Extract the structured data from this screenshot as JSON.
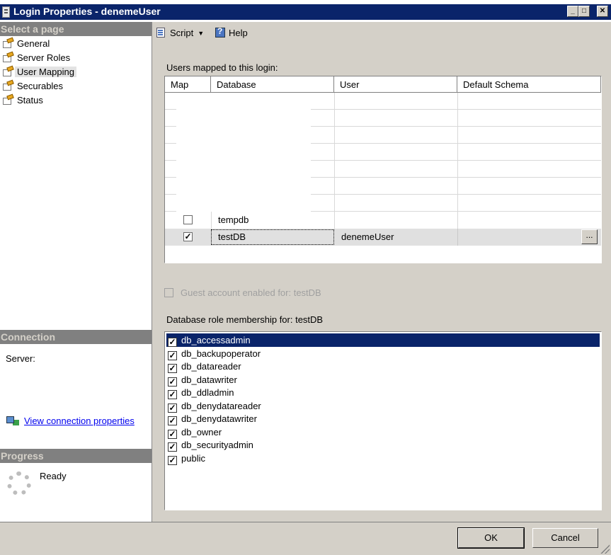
{
  "window": {
    "title": "Login Properties - denemeUser"
  },
  "sidebar": {
    "select_page_header": "Select a page",
    "pages": [
      {
        "label": "General",
        "selected": false
      },
      {
        "label": "Server Roles",
        "selected": false
      },
      {
        "label": "User Mapping",
        "selected": true
      },
      {
        "label": "Securables",
        "selected": false
      },
      {
        "label": "Status",
        "selected": false
      }
    ],
    "connection_header": "Connection",
    "server_label": "Server:",
    "view_connection_link": "View connection properties",
    "progress_header": "Progress",
    "progress_status": "Ready"
  },
  "toolbar": {
    "script_label": "Script",
    "help_label": "Help"
  },
  "mapping": {
    "users_label": "Users mapped to this login:",
    "columns": [
      "Map",
      "Database",
      "User",
      "Default Schema"
    ],
    "rows": [
      {
        "map": false,
        "database": "tempdb",
        "user": "",
        "schema": ""
      },
      {
        "map": true,
        "database": "testDB",
        "user": "denemeUser",
        "schema": ""
      }
    ],
    "ellipsis_label": "...",
    "guest_label": "Guest account enabled for: testDB"
  },
  "roles": {
    "label": "Database role membership for: testDB",
    "items": [
      {
        "name": "db_accessadmin",
        "checked": true,
        "selected": true
      },
      {
        "name": "db_backupoperator",
        "checked": true,
        "selected": false
      },
      {
        "name": "db_datareader",
        "checked": true,
        "selected": false
      },
      {
        "name": "db_datawriter",
        "checked": true,
        "selected": false
      },
      {
        "name": "db_ddladmin",
        "checked": true,
        "selected": false
      },
      {
        "name": "db_denydatareader",
        "checked": true,
        "selected": false
      },
      {
        "name": "db_denydatawriter",
        "checked": true,
        "selected": false
      },
      {
        "name": "db_owner",
        "checked": true,
        "selected": false
      },
      {
        "name": "db_securityadmin",
        "checked": true,
        "selected": false
      },
      {
        "name": "public",
        "checked": true,
        "selected": false
      }
    ]
  },
  "buttons": {
    "ok_label": "OK",
    "cancel_label": "Cancel"
  }
}
